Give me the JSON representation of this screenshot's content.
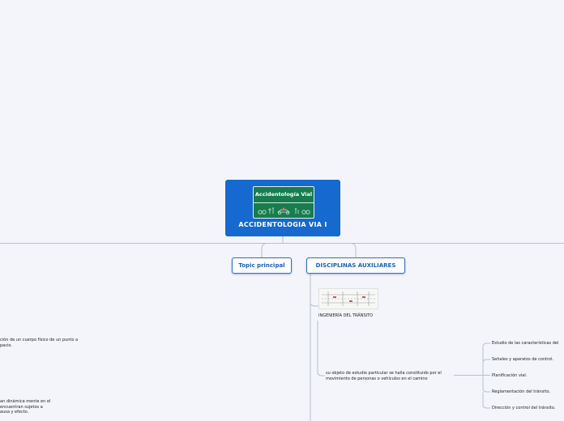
{
  "root": {
    "title": "ACCIDENTOLOGIA VIA I",
    "badge_title": "Accidentología Vial",
    "badge_icons": "traffic-scene-icons"
  },
  "topics": [
    {
      "label": "Topic principal"
    },
    {
      "label": "DISCIPLINAS AUXILIARES"
    }
  ],
  "subtopics": {
    "ingenieria": "INGENIERÍA DEL TRÁNSITO",
    "objeto_line1": "su objeto de estudio particular se halla constituido por el",
    "objeto_line2": "movimiento de personas o vehículos en el camino",
    "items": [
      "Estudio de las características del",
      "Señales y aparatos de control.",
      "Planificación vial.",
      "Reglamentación del tránsito.",
      "Dirección y control del tránsito."
    ]
  },
  "left_fragments": {
    "a_line1": "ción de un cuerpo físico de un punto a",
    "a_line2": "pacio.",
    "b_line1": "an dinámica mente en el",
    "b_line2": "encuentran sujetos a",
    "b_line3": "ausa y efecto."
  },
  "colors": {
    "root_bg": "#1669cf",
    "badge_bg": "#177c4e",
    "topic_border": "#2f6fc9",
    "connector": "#b9bfc9"
  }
}
